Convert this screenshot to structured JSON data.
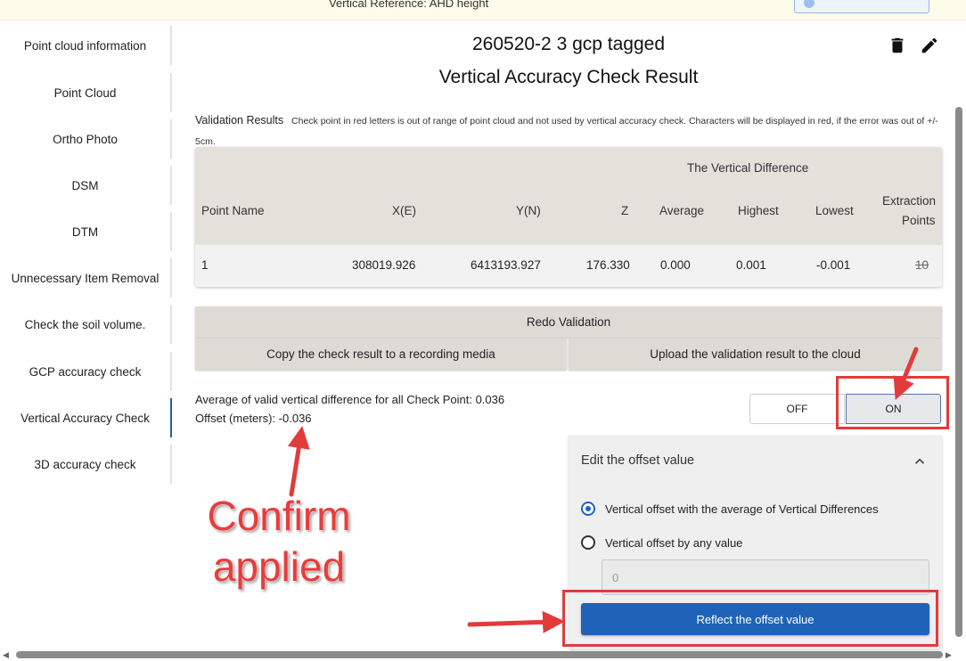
{
  "top_bar": {
    "vertical_reference": "Vertical Reference: AHD height"
  },
  "sidebar": {
    "items": [
      {
        "label": "Point cloud information"
      },
      {
        "label": "Point Cloud"
      },
      {
        "label": "Ortho Photo"
      },
      {
        "label": "DSM"
      },
      {
        "label": "DTM"
      },
      {
        "label": "Unnecessary Item Removal"
      },
      {
        "label": "Check the soil volume."
      },
      {
        "label": "GCP accuracy check"
      },
      {
        "label": "Vertical Accuracy Check",
        "active": true
      },
      {
        "label": "3D accuracy check"
      }
    ]
  },
  "header": {
    "title": "260520-2 3 gcp tagged",
    "subtitle": "Vertical Accuracy Check Result",
    "icons": [
      "delete-icon",
      "edit-icon"
    ]
  },
  "validation": {
    "label": "Validation Results",
    "description": "Check point in red letters is out of range of point cloud and not used by vertical accuracy check. Characters will be displayed in red, if the error was out of +/- 5cm."
  },
  "table": {
    "group_header": "The Vertical Difference",
    "columns": {
      "point_name": "Point Name",
      "x": "X(E)",
      "y": "Y(N)",
      "z": "Z",
      "average": "Average",
      "highest": "Highest",
      "lowest": "Lowest",
      "extraction_line1": "Extraction",
      "extraction_line2": "Points"
    },
    "rows": [
      {
        "point_name": "1",
        "x": "308019.926",
        "y": "6413193.927",
        "z": "176.330",
        "average": "0.000",
        "highest": "0.001",
        "lowest": "-0.001",
        "extraction_points": "10"
      }
    ]
  },
  "actions": {
    "redo": "Redo Validation",
    "copy": "Copy the check result to a recording media",
    "upload": "Upload the validation result to the cloud"
  },
  "summary": {
    "average_line": "Average of valid vertical difference for all Check Point: 0.036",
    "offset_line": "Offset (meters): -0.036"
  },
  "toggle": {
    "off_label": "OFF",
    "on_label": "ON",
    "selected": "ON"
  },
  "offset_panel": {
    "heading": "Edit the offset value",
    "option_average": "Vertical offset with the average of Vertical Differences",
    "option_any": "Vertical offset by any value",
    "selected_option": "average",
    "input_value": "0",
    "reflect_button": "Reflect the offset value"
  },
  "annotation": {
    "line1": "Confirm",
    "line2": "applied",
    "color": "#e23b3b"
  },
  "colors": {
    "accent": "#1f63b8",
    "annotation_red": "#e23b3b"
  }
}
